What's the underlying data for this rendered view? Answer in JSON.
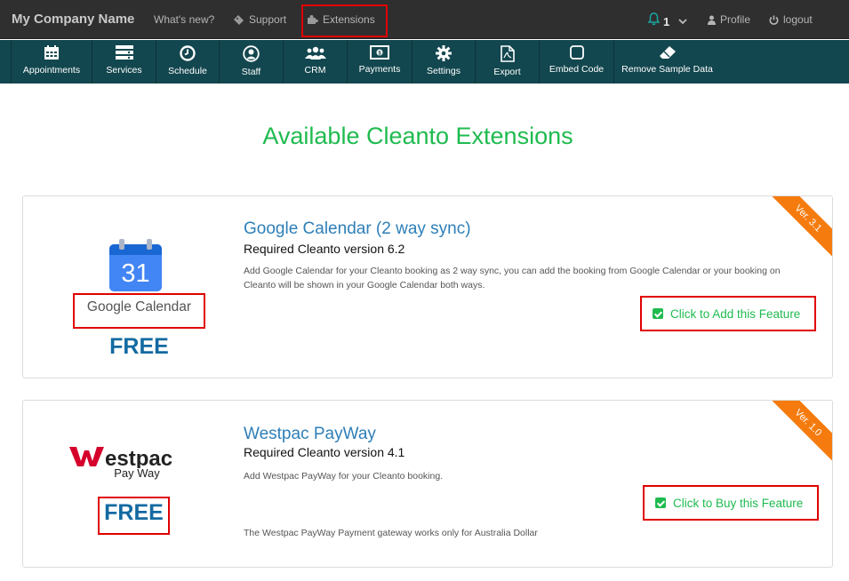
{
  "topbar": {
    "brand": "My Company Name",
    "whats_new": "What's new?",
    "support": "Support",
    "extensions": "Extensions",
    "notifications_count": "1",
    "profile": "Profile",
    "logout": "logout"
  },
  "toolbar": {
    "items": [
      {
        "label": "Appointments",
        "icon": "calendar-icon"
      },
      {
        "label": "Services",
        "icon": "services-icon"
      },
      {
        "label": "Schedule",
        "icon": "clock-icon"
      },
      {
        "label": "Staff",
        "icon": "user-circle-icon"
      },
      {
        "label": "CRM",
        "icon": "users-group-icon"
      },
      {
        "label": "Payments",
        "icon": "money-icon"
      },
      {
        "label": "Settings",
        "icon": "gear-icon"
      },
      {
        "label": "Export",
        "icon": "pdf-file-icon"
      },
      {
        "label": "Embed Code",
        "icon": "square-icon"
      },
      {
        "label": "Remove Sample Data",
        "icon": "eraser-icon"
      }
    ]
  },
  "page": {
    "title": "Available Cleanto Extensions"
  },
  "extensions": [
    {
      "name": "Google Calendar (2 way sync)",
      "required": "Required Cleanto version 6.2",
      "description": "Add Google Calendar for your Cleanto booking as 2 way sync, you can add the booking from Google Calendar or your booking on Cleanto will be shown in your Google Calendar both ways.",
      "note": "",
      "price": "FREE",
      "version": "Ver. 3.1",
      "button": "Click to Add this Feature",
      "logo_text": "Google Calendar",
      "logo_day": "31"
    },
    {
      "name": "Westpac PayWay",
      "required": "Required Cleanto version 4.1",
      "description": "Add Westpac PayWay for your Cleanto booking.",
      "note": "The Westpac PayWay Payment gateway works only for Australia Dollar",
      "price": "FREE",
      "version": "Ver. 1.0",
      "button": "Click to Buy this Feature",
      "logo_text": "estpac",
      "logo_sub": "Pay Way"
    }
  ],
  "colors": {
    "accent_green": "#1fbb4f",
    "toolbar_bg": "#13474f",
    "topbar_bg": "#2f2f2f",
    "ribbon_orange": "#f57b0f",
    "highlight_red": "#e00000",
    "link_blue": "#2e7fb8"
  }
}
